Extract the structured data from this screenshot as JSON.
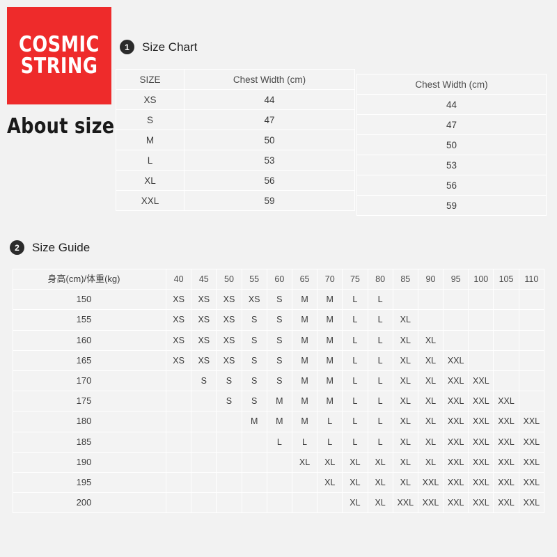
{
  "brand": {
    "logo_line1": "COSMIC",
    "logo_line2": "STRING",
    "logo_bg_color": "#ee2b2b",
    "logo_text_color": "#ffffff",
    "tagline": "About size"
  },
  "sections": [
    {
      "badge": "1",
      "title": "Size Chart"
    },
    {
      "badge": "2",
      "title": "Size Guide"
    }
  ],
  "size_chart": {
    "left_table": {
      "headers": [
        "SIZE",
        "Chest Width (cm)"
      ],
      "rows": [
        {
          "size": "XS",
          "chest": "44"
        },
        {
          "size": "S",
          "chest": "47"
        },
        {
          "size": "M",
          "chest": "50"
        },
        {
          "size": "L",
          "chest": "53"
        },
        {
          "size": "XL",
          "chest": "56"
        },
        {
          "size": "XXL",
          "chest": "59"
        }
      ]
    },
    "right_table": {
      "header": "Chest Width (cm)",
      "values": [
        "44",
        "47",
        "50",
        "53",
        "56",
        "59"
      ]
    }
  },
  "size_guide": {
    "corner_label": "身高(cm)/体重(kg)",
    "weights": [
      "40",
      "45",
      "50",
      "55",
      "60",
      "65",
      "70",
      "75",
      "80",
      "85",
      "90",
      "95",
      "100",
      "105",
      "110"
    ],
    "heights": [
      "150",
      "155",
      "160",
      "165",
      "170",
      "175",
      "180",
      "185",
      "190",
      "195",
      "200"
    ],
    "matrix": [
      [
        "XS",
        "XS",
        "XS",
        "XS",
        "S",
        "M",
        "M",
        "L",
        "L",
        "",
        "",
        "",
        "",
        "",
        ""
      ],
      [
        "XS",
        "XS",
        "XS",
        "S",
        "S",
        "M",
        "M",
        "L",
        "L",
        "XL",
        "",
        "",
        "",
        "",
        ""
      ],
      [
        "XS",
        "XS",
        "XS",
        "S",
        "S",
        "M",
        "M",
        "L",
        "L",
        "XL",
        "XL",
        "",
        "",
        "",
        ""
      ],
      [
        "XS",
        "XS",
        "XS",
        "S",
        "S",
        "M",
        "M",
        "L",
        "L",
        "XL",
        "XL",
        "XXL",
        "",
        "",
        ""
      ],
      [
        "",
        "S",
        "S",
        "S",
        "S",
        "M",
        "M",
        "L",
        "L",
        "XL",
        "XL",
        "XXL",
        "XXL",
        "",
        ""
      ],
      [
        "",
        "",
        "S",
        "S",
        "M",
        "M",
        "M",
        "L",
        "L",
        "XL",
        "XL",
        "XXL",
        "XXL",
        "XXL",
        ""
      ],
      [
        "",
        "",
        "",
        "M",
        "M",
        "M",
        "L",
        "L",
        "L",
        "XL",
        "XL",
        "XXL",
        "XXL",
        "XXL",
        "XXL"
      ],
      [
        "",
        "",
        "",
        "",
        "L",
        "L",
        "L",
        "L",
        "L",
        "XL",
        "XL",
        "XXL",
        "XXL",
        "XXL",
        "XXL"
      ],
      [
        "",
        "",
        "",
        "",
        "",
        "XL",
        "XL",
        "XL",
        "XL",
        "XL",
        "XL",
        "XXL",
        "XXL",
        "XXL",
        "XXL"
      ],
      [
        "",
        "",
        "",
        "",
        "",
        "",
        "XL",
        "XL",
        "XL",
        "XL",
        "XXL",
        "XXL",
        "XXL",
        "XXL",
        "XXL"
      ],
      [
        "",
        "",
        "",
        "",
        "",
        "",
        "",
        "XL",
        "XL",
        "XXL",
        "XXL",
        "XXL",
        "XXL",
        "XXL",
        "XXL"
      ]
    ]
  }
}
